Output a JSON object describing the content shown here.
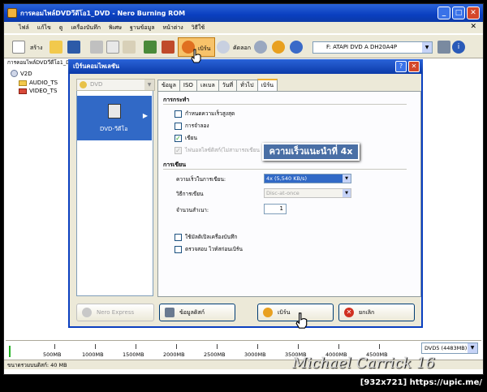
{
  "app": {
    "title": "การคอมไพล์DVDวีดีโอ1_DVD - Nero Burning ROM"
  },
  "menu": [
    "ไฟล์",
    "แก้ไข",
    "ดู",
    "เครื่องบันทึก",
    "พิเศษ",
    "ฐานข้อมูล",
    "หน้าต่าง",
    "วิธีใช้"
  ],
  "toolbar": {
    "new_label": "สร้าง",
    "burn_label": "เบิร์น",
    "copy_label": "คัดลอก",
    "drive": "F: ATAPI DVD A  DH20A4P"
  },
  "path": "การคอมไพล์DVDวีดีโอ1_DVD",
  "tree": {
    "root": "V2D",
    "items": [
      "AUDIO_TS",
      "VIDEO_TS"
    ]
  },
  "capacity": {
    "ticks": [
      "500MB",
      "1000MB",
      "1500MB",
      "2000MB",
      "2500MB",
      "3000MB",
      "3500MB",
      "4000MB",
      "4500MB"
    ],
    "disc": "DVD5 (4483MB)"
  },
  "status": "ขนาดรวมบนดิสก์: 40 MB",
  "dialog": {
    "title": "เบิร์นคอมไพเลชัน",
    "left_combo": "DVD",
    "left_item": "DVD-วีดีโอ",
    "tabs": [
      "ข้อมูล",
      "ISO",
      "เลเบล",
      "วันที่",
      "ทั่วไป",
      "เบิร์น"
    ],
    "sections": {
      "action": "การกระทำ",
      "write": "การเขียน"
    },
    "checks": [
      {
        "label": "กำหนดความเร็วสูงสุด",
        "checked": false,
        "disabled": false
      },
      {
        "label": "การจำลอง",
        "checked": false,
        "disabled": false
      },
      {
        "label": "เขียน",
        "checked": true,
        "disabled": false
      },
      {
        "label": "ไฟนอลไลซ์ดิสก์(ไม่สามารถเขียน",
        "checked": true,
        "disabled": true
      }
    ],
    "fields": {
      "speed_label": "ความเร็วในการเขียน:",
      "speed_value": "4x (5,540 KB/s)",
      "method_label": "วิธีการเขียน",
      "method_value": "Disc-at-once",
      "copies_label": "จำนวนสำเนา:",
      "copies_value": "1"
    },
    "checks2": [
      {
        "label": "ใช้มัลติเปิลเครื่องบันทึก",
        "checked": false
      },
      {
        "label": "ตรวจสอบ ไวท์สก่อนเบิร์น",
        "checked": false
      }
    ],
    "callout": "ความเร็วแนะนำที่ 4x",
    "buttons": {
      "nero_express": "Nero Express",
      "info": "ข้อมูลดิสก์",
      "burn": "เบิร์น",
      "cancel": "ยกเลิก"
    }
  },
  "watermark": "Michael Carrick 16",
  "footer": "[932x721] https://upic.me/",
  "colors": {
    "titlebar": "#0b3aa8",
    "selection": "#3169c6",
    "callout": "#4a6fa5"
  }
}
